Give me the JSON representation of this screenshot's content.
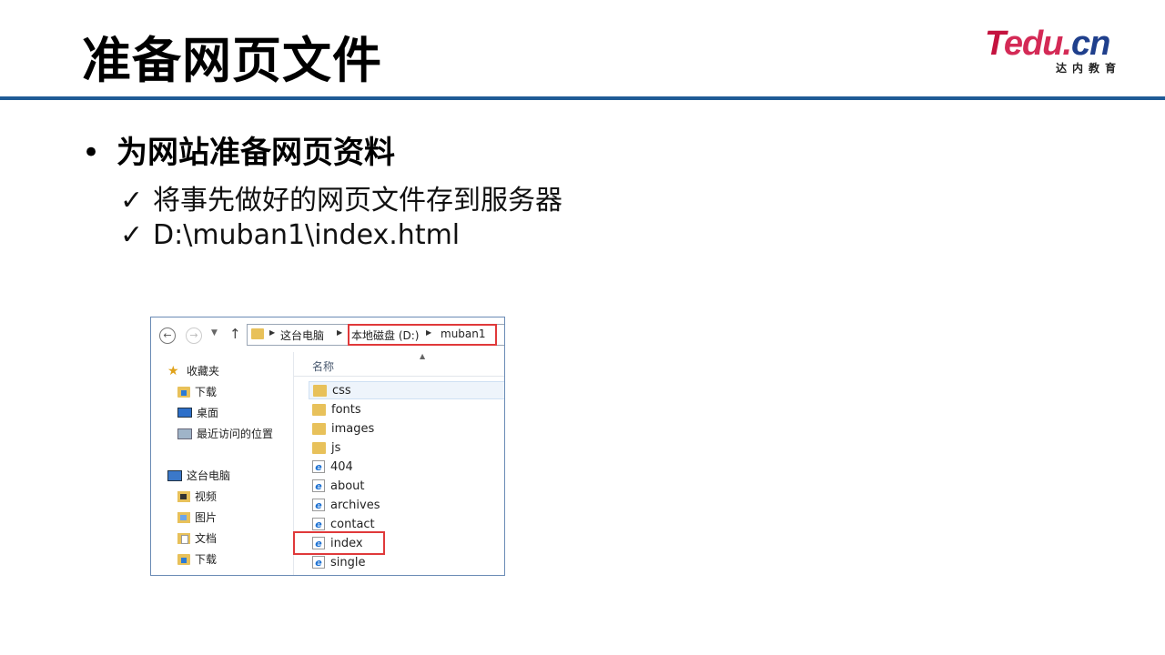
{
  "slide": {
    "title": "准备网页文件",
    "logo": {
      "main_t": "T",
      "main_rest": "edu.",
      "main_cn": "cn",
      "sub": "达内教育"
    },
    "bullet_dot": "•",
    "bullet_main": "为网站准备网页资料",
    "check_mark": "✓",
    "sub_bullets": [
      "将事先做好的网页文件存到服务器",
      "D:\\muban1\\index.html"
    ]
  },
  "explorer": {
    "nav_buttons": {
      "back_icon": "arrow-left-icon",
      "forward_icon": "arrow-right-icon",
      "dropdown_icon": "chevron-down-icon",
      "up_icon": "arrow-up-icon"
    },
    "address": {
      "segments": [
        "这台电脑",
        "本地磁盘 (D:)",
        "muban1"
      ]
    },
    "nav_pane": {
      "favorites_label": "收藏夹",
      "favorites": [
        "下载",
        "桌面",
        "最近访问的位置"
      ],
      "pc_label": "这台电脑",
      "pc_items": [
        "视频",
        "图片",
        "文档",
        "下载"
      ]
    },
    "column_header": "名称",
    "files": [
      {
        "name": "css",
        "type": "folder"
      },
      {
        "name": "fonts",
        "type": "folder"
      },
      {
        "name": "images",
        "type": "folder"
      },
      {
        "name": "js",
        "type": "folder"
      },
      {
        "name": "404",
        "type": "html"
      },
      {
        "name": "about",
        "type": "html"
      },
      {
        "name": "archives",
        "type": "html"
      },
      {
        "name": "contact",
        "type": "html"
      },
      {
        "name": "index",
        "type": "html"
      },
      {
        "name": "single",
        "type": "html"
      }
    ],
    "colors": {
      "highlight": "#e0393a",
      "rule": "#1f5b96",
      "folder": "#e8c15a"
    }
  }
}
